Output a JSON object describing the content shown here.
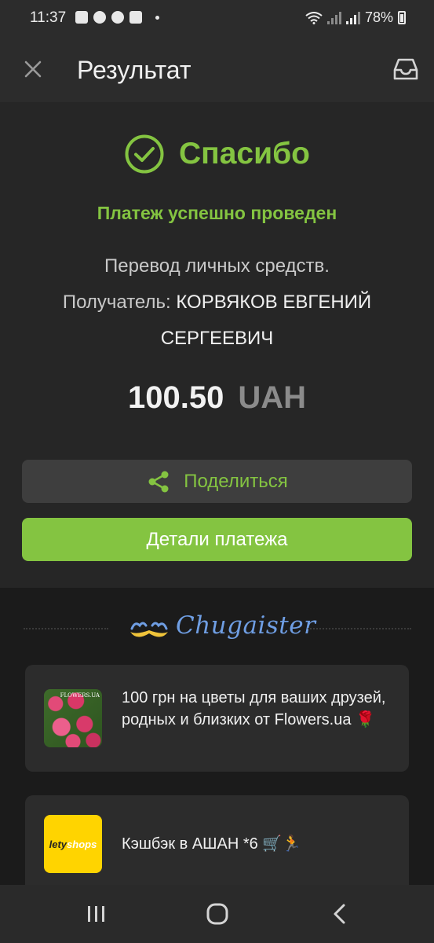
{
  "status_bar": {
    "time": "11:37",
    "battery": "78%",
    "icons": [
      "message-icon",
      "facebook-icon",
      "facebook-icon",
      "close-box-icon",
      "dot-icon",
      "wifi-icon",
      "signal-icon",
      "signal-icon",
      "battery-icon"
    ]
  },
  "header": {
    "title": "Результат",
    "close_icon": "close-icon",
    "inbox_icon": "inbox-icon"
  },
  "result": {
    "title": "Спасибо",
    "status": "Платеж успешно проведен",
    "description": "Перевод личных средств.",
    "recipient_label": "Получатель:",
    "recipient_name": "КОРВЯКОВ ЕВГЕНИЙ СЕРГЕЕВИЧ",
    "amount": "100.50",
    "currency": "UAH",
    "share_label": "Поделиться",
    "details_label": "Детали платежа",
    "accent_color": "#84c441"
  },
  "promo": {
    "brand": "Chugaister",
    "items": [
      {
        "text": "100 грн на цветы для ваших друзей, родных и близких от Flowers.ua 🌹",
        "thumb": "flowers-ua-thumbnail",
        "thumb_label": "FLOWERS.UA"
      },
      {
        "text": "Кэшбэк в АШАН *6 🛒🏃",
        "thumb": "letyshops-logo",
        "thumb_label_a": "lety",
        "thumb_label_b": "shops"
      }
    ]
  },
  "nav_bar": {
    "icons": [
      "recents-icon",
      "home-icon",
      "back-icon"
    ]
  }
}
